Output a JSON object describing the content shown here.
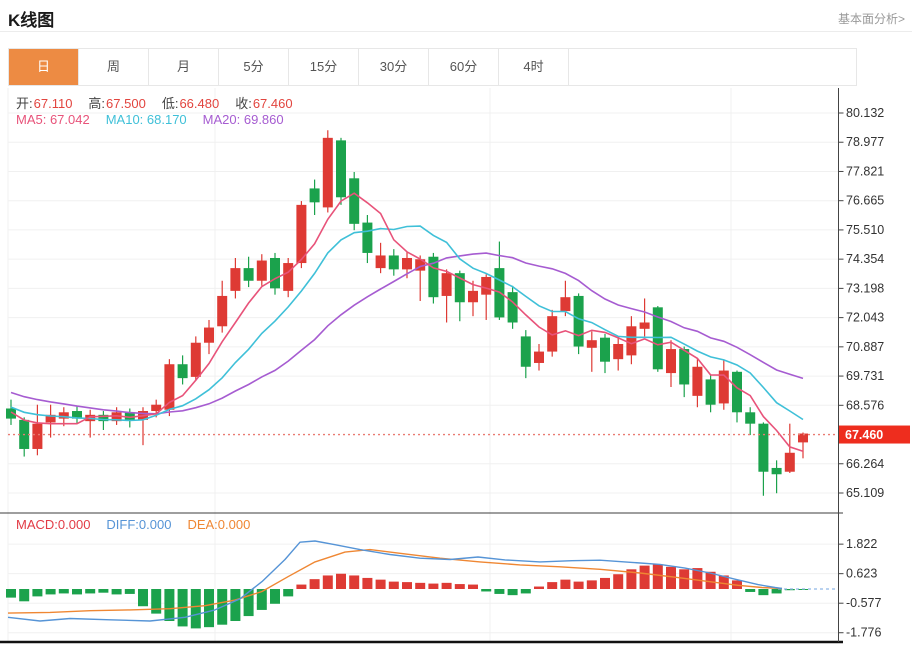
{
  "header": {
    "title": "K线图",
    "link": "基本面分析>"
  },
  "tabs": {
    "items": [
      "日",
      "周",
      "月",
      "5分",
      "15分",
      "30分",
      "60分",
      "4时"
    ],
    "active_index": 0
  },
  "quote_row": [
    {
      "key": "open",
      "label": "开:",
      "value": "67.110"
    },
    {
      "key": "high",
      "label": "高:",
      "value": "67.500"
    },
    {
      "key": "low",
      "label": "低:",
      "value": "66.480"
    },
    {
      "key": "close",
      "label": "收:",
      "value": "67.460"
    }
  ],
  "ma_row": [
    {
      "key": "ma5",
      "text": "MA5: 67.042",
      "color": "#e8537a"
    },
    {
      "key": "ma10",
      "text": "MA10: 68.170",
      "color": "#3fc0d8"
    },
    {
      "key": "ma20",
      "text": "MA20: 69.860",
      "color": "#a65cd1"
    }
  ],
  "macd_row": [
    {
      "key": "macd",
      "text": "MACD:0.000",
      "color": "#e23b45"
    },
    {
      "key": "diff",
      "text": "DIFF:0.000",
      "color": "#5694d6"
    },
    {
      "key": "dea",
      "text": "DEA:0.000",
      "color": "#ef8733"
    }
  ],
  "colors": {
    "up": "#de3a34",
    "down": "#1ba24c",
    "ma5": "#e8537a",
    "ma10": "#3fc0d8",
    "ma20": "#a65cd1",
    "diff": "#5694d6",
    "dea": "#ef8733",
    "tab_accent": "#ed8b43",
    "price_tag_bg": "#ee2d1e",
    "price_tag_text": "#ffffff",
    "dotted_line": "#e97b72",
    "grid": "#f0f0f0",
    "axis": "#444444",
    "axis_label": "#333333",
    "zero_dash": "#8fb8e6",
    "quote_label": "#444444",
    "quote_value": "#e2453f"
  },
  "chart_data": {
    "type": "candlestick+macd",
    "title": "K线图",
    "ohlc": {
      "open": 67.11,
      "high": 67.5,
      "low": 66.48,
      "close": 67.46
    },
    "ma_values": {
      "MA5": 67.042,
      "MA10": 68.17,
      "MA20": 69.86
    },
    "macd_values": {
      "MACD": 0.0,
      "DIFF": 0.0,
      "DEA": 0.0
    },
    "price_ticks": [
      80.132,
      78.977,
      77.821,
      76.665,
      75.51,
      74.354,
      73.198,
      72.043,
      70.887,
      69.731,
      68.576,
      67.46,
      66.264,
      65.109
    ],
    "current_price": 67.46,
    "macd_ticks": [
      1.822,
      0.623,
      -0.577,
      -1.776
    ],
    "grid_vlines_x": [
      215,
      490,
      731
    ],
    "candles": [
      [
        68.45,
        68.8,
        67.8,
        68.05
      ],
      [
        68.0,
        68.1,
        66.55,
        66.85
      ],
      [
        66.85,
        68.6,
        66.6,
        67.85
      ],
      [
        67.9,
        68.6,
        67.3,
        68.2
      ],
      [
        68.05,
        68.5,
        67.75,
        68.3
      ],
      [
        68.35,
        68.55,
        67.85,
        68.05
      ],
      [
        67.95,
        68.4,
        67.3,
        68.2
      ],
      [
        68.2,
        68.35,
        67.6,
        67.95
      ],
      [
        67.95,
        68.5,
        67.8,
        68.3
      ],
      [
        68.3,
        68.45,
        67.7,
        68.0
      ],
      [
        68.0,
        68.5,
        67.0,
        68.35
      ],
      [
        68.35,
        68.8,
        68.1,
        68.6
      ],
      [
        68.4,
        70.4,
        68.15,
        70.2
      ],
      [
        70.2,
        70.55,
        69.4,
        69.65
      ],
      [
        69.7,
        71.3,
        69.55,
        71.05
      ],
      [
        71.05,
        71.95,
        70.6,
        71.65
      ],
      [
        71.7,
        73.5,
        71.45,
        72.9
      ],
      [
        73.1,
        74.4,
        72.8,
        74.0
      ],
      [
        74.0,
        74.45,
        73.25,
        73.5
      ],
      [
        73.5,
        74.55,
        73.3,
        74.3
      ],
      [
        74.4,
        74.6,
        72.95,
        73.2
      ],
      [
        73.1,
        74.4,
        72.85,
        74.2
      ],
      [
        74.2,
        76.65,
        74.0,
        76.5
      ],
      [
        77.15,
        77.5,
        76.1,
        76.6
      ],
      [
        76.4,
        79.45,
        76.2,
        79.15
      ],
      [
        79.05,
        79.15,
        76.5,
        76.8
      ],
      [
        77.55,
        77.8,
        75.5,
        75.75
      ],
      [
        75.8,
        76.1,
        74.2,
        74.6
      ],
      [
        74.0,
        75.0,
        73.8,
        74.5
      ],
      [
        74.5,
        74.75,
        73.7,
        73.95
      ],
      [
        73.95,
        74.65,
        73.6,
        74.4
      ],
      [
        73.9,
        74.5,
        72.7,
        74.35
      ],
      [
        74.45,
        74.6,
        72.6,
        72.85
      ],
      [
        72.9,
        73.95,
        71.85,
        73.8
      ],
      [
        73.8,
        73.9,
        71.9,
        72.65
      ],
      [
        72.65,
        73.5,
        72.1,
        73.1
      ],
      [
        72.95,
        73.75,
        71.95,
        73.65
      ],
      [
        74.0,
        75.05,
        71.95,
        72.05
      ],
      [
        73.05,
        73.3,
        71.6,
        71.85
      ],
      [
        71.3,
        71.55,
        69.65,
        70.1
      ],
      [
        70.25,
        71.0,
        69.95,
        70.7
      ],
      [
        70.7,
        72.35,
        70.5,
        72.1
      ],
      [
        72.3,
        73.5,
        72.1,
        72.85
      ],
      [
        72.9,
        73.0,
        70.6,
        70.9
      ],
      [
        70.85,
        71.5,
        69.9,
        71.15
      ],
      [
        71.25,
        71.4,
        69.85,
        70.3
      ],
      [
        70.4,
        71.3,
        69.95,
        71.0
      ],
      [
        70.55,
        72.1,
        70.2,
        71.7
      ],
      [
        71.6,
        72.8,
        71.3,
        71.85
      ],
      [
        72.45,
        72.5,
        69.9,
        70.0
      ],
      [
        69.85,
        71.15,
        69.3,
        70.8
      ],
      [
        70.8,
        70.9,
        68.9,
        69.4
      ],
      [
        68.95,
        70.4,
        68.5,
        70.1
      ],
      [
        69.6,
        69.8,
        68.3,
        68.6
      ],
      [
        68.65,
        70.35,
        68.4,
        69.95
      ],
      [
        69.9,
        69.95,
        67.9,
        68.3
      ],
      [
        68.3,
        68.5,
        67.4,
        67.85
      ],
      [
        67.85,
        67.9,
        65.0,
        65.95
      ],
      [
        66.1,
        66.4,
        65.1,
        65.85
      ],
      [
        65.95,
        67.85,
        65.9,
        66.7
      ],
      [
        67.11,
        67.5,
        66.48,
        67.46
      ]
    ],
    "ma_seed_closes": [
      70.2,
      70.1,
      70.0,
      69.9,
      69.8,
      69.6,
      69.5,
      69.3,
      69.2,
      69.0,
      68.9,
      68.8,
      68.7,
      68.6,
      68.5,
      68.45,
      68.4,
      68.35,
      68.3
    ],
    "macd_hist": [
      -0.35,
      -0.5,
      -0.3,
      -0.22,
      -0.18,
      -0.22,
      -0.18,
      -0.15,
      -0.22,
      -0.2,
      -0.7,
      -1.0,
      -1.3,
      -1.52,
      -1.6,
      -1.55,
      -1.45,
      -1.3,
      -1.1,
      -0.85,
      -0.6,
      -0.3,
      0.18,
      0.4,
      0.55,
      0.62,
      0.55,
      0.45,
      0.38,
      0.3,
      0.28,
      0.25,
      0.22,
      0.25,
      0.2,
      0.18,
      -0.1,
      -0.2,
      -0.25,
      -0.18,
      0.1,
      0.28,
      0.38,
      0.3,
      0.35,
      0.45,
      0.6,
      0.8,
      0.95,
      1.0,
      0.9,
      0.8,
      0.85,
      0.7,
      0.55,
      0.35,
      -0.12,
      -0.25,
      -0.18,
      -0.05,
      -0.02
    ],
    "diff_line": [
      [
        8,
        -1.15
      ],
      [
        40,
        -1.3
      ],
      [
        70,
        -1.2
      ],
      [
        110,
        -1.25
      ],
      [
        150,
        -1.3
      ],
      [
        185,
        -1.15
      ],
      [
        215,
        -0.85
      ],
      [
        240,
        -0.4
      ],
      [
        262,
        0.3
      ],
      [
        285,
        1.2
      ],
      [
        300,
        1.9
      ],
      [
        315,
        1.95
      ],
      [
        335,
        1.8
      ],
      [
        360,
        1.6
      ],
      [
        390,
        1.4
      ],
      [
        420,
        1.25
      ],
      [
        450,
        1.2
      ],
      [
        478,
        1.3
      ],
      [
        505,
        1.18
      ],
      [
        540,
        1.1
      ],
      [
        572,
        1.15
      ],
      [
        600,
        1.17
      ],
      [
        632,
        1.08
      ],
      [
        660,
        1.0
      ],
      [
        685,
        0.85
      ],
      [
        710,
        0.65
      ],
      [
        735,
        0.4
      ],
      [
        758,
        0.18
      ],
      [
        775,
        0.06
      ],
      [
        782,
        0.02
      ]
    ],
    "dea_line": [
      [
        8,
        -0.98
      ],
      [
        50,
        -0.95
      ],
      [
        90,
        -0.88
      ],
      [
        130,
        -0.85
      ],
      [
        170,
        -0.8
      ],
      [
        205,
        -0.68
      ],
      [
        235,
        -0.45
      ],
      [
        262,
        -0.1
      ],
      [
        288,
        0.5
      ],
      [
        315,
        1.1
      ],
      [
        345,
        1.5
      ],
      [
        370,
        1.6
      ],
      [
        400,
        1.45
      ],
      [
        440,
        1.25
      ],
      [
        480,
        1.1
      ],
      [
        520,
        0.98
      ],
      [
        560,
        0.9
      ],
      [
        600,
        0.8
      ],
      [
        640,
        0.65
      ],
      [
        675,
        0.48
      ],
      [
        705,
        0.32
      ],
      [
        738,
        0.15
      ],
      [
        762,
        0.06
      ],
      [
        782,
        0.02
      ]
    ]
  }
}
